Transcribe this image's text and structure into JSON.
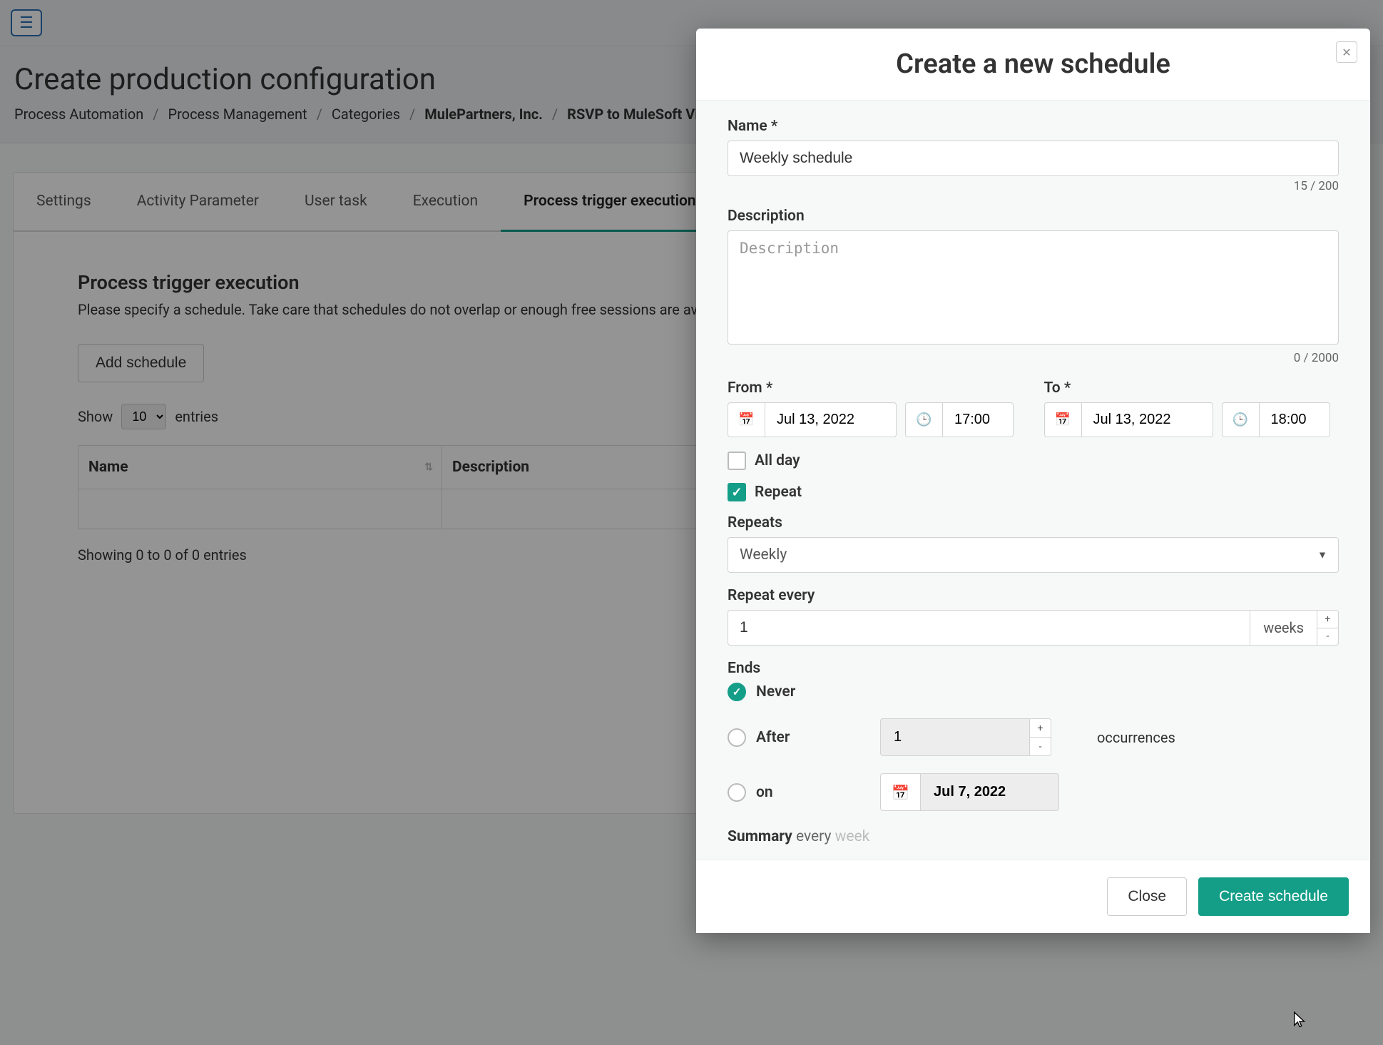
{
  "header": {
    "page_title": "Create production configuration",
    "breadcrumb": [
      {
        "label": "Process Automation",
        "strong": false
      },
      {
        "label": "Process Management",
        "strong": false
      },
      {
        "label": "Categories",
        "strong": false
      },
      {
        "label": "MulePartners, Inc.",
        "strong": true
      },
      {
        "label": "RSVP to MuleSoft Virtua",
        "strong": true
      }
    ]
  },
  "tabs": [
    {
      "label": "Settings",
      "active": false
    },
    {
      "label": "Activity Parameter",
      "active": false
    },
    {
      "label": "User task",
      "active": false
    },
    {
      "label": "Execution",
      "active": false
    },
    {
      "label": "Process trigger execution",
      "active": true
    }
  ],
  "section": {
    "title": "Process trigger execution",
    "desc": "Please specify a schedule. Take care that schedules do not overlap or enough free sessions are av",
    "add_button": "Add schedule",
    "show_label_pre": "Show",
    "show_value": "10",
    "show_label_post": "entries",
    "columns": {
      "name": "Name",
      "description": "Description"
    },
    "info": "Showing 0 to 0 of 0 entries"
  },
  "modal": {
    "title": "Create a new schedule",
    "name_label": "Name *",
    "name_value": "Weekly schedule",
    "name_counter": "15 / 200",
    "desc_label": "Description",
    "desc_placeholder": "Description",
    "desc_counter": "0 / 2000",
    "from_label": "From *",
    "from_date": "Jul 13, 2022",
    "from_time": "17:00",
    "to_label": "To *",
    "to_date": "Jul 13, 2022",
    "to_time": "18:00",
    "all_day_label": "All day",
    "all_day_checked": false,
    "repeat_label": "Repeat",
    "repeat_checked": true,
    "repeats_label": "Repeats",
    "repeats_value": "Weekly",
    "repeat_every_label": "Repeat every",
    "repeat_every_value": "1",
    "repeat_every_unit": "weeks",
    "ends_label": "Ends",
    "ends_options": {
      "never": "Never",
      "after": "After",
      "on": "on"
    },
    "ends_selected": "never",
    "after_value": "1",
    "occurrences_label": "occurrences",
    "on_date": "Jul 7, 2022",
    "summary_label": "Summary",
    "summary_every": "every",
    "summary_week": "week",
    "close_btn": "Close",
    "create_btn": "Create schedule"
  }
}
